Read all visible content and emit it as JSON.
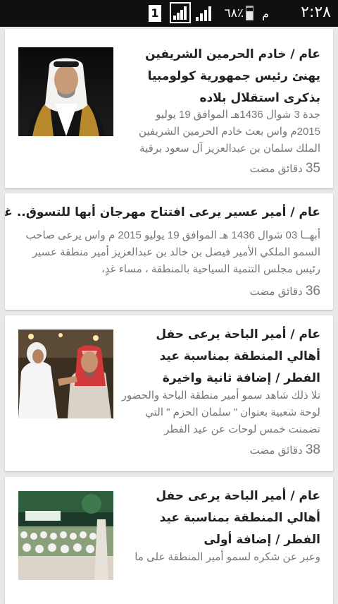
{
  "status_bar": {
    "time": "٢:٢٨",
    "period": "م",
    "battery_percent": "٦٨٪",
    "battery_level": 0.68,
    "sim_slot": "1"
  },
  "articles": [
    {
      "title": "عام / خادم الحرمين الشريفين يهنئ رئيس جمهورية كولومبيا بذكرى استقلال بلاده",
      "summary": "جدة 3 شوال 1436هـ الموافق 19 يوليو 2015م واس بعث خادم الحرمين الشريفين الملك سلمان بن عبدالعزيز آل سعود برقية",
      "time_num": "35",
      "time_text": "دقائق مضت",
      "has_image": true,
      "image_icon": "portrait-photo"
    },
    {
      "title": "عام / أمير عسير يرعى افتتاح مهرجان أبها للتسوق.. غدًا",
      "summary": "أبهــا 03 شوال 1436 هـ الموافق 19 يوليو 2015 م واس يرعى صاحب السمو الملكي الأمير فيصل بن خالد بن عبدالعزيز أمير منطقة عسير رئيس مجلس التنمية السياحية بالمنطقة ، مساء غدٍ،",
      "time_num": "36",
      "time_text": "دقائق مضت",
      "has_image": false
    },
    {
      "title": "عام / أمير الباحة يرعى حفل أهالي المنطقة بمناسبة عيد الفطر / إضافة ثانية واخيرة",
      "summary": "تلا ذلك شاهد سمو أمير منطقة الباحة والحضور لوحة شعبية بعنوان \" سلمان الحزم \" التي تضمنت خمس لوحات عن عيد الفطر",
      "time_num": "38",
      "time_text": "دقائق مضت",
      "has_image": true,
      "image_icon": "event-photo"
    },
    {
      "title": "عام / أمير الباحة يرعى حفل أهالي المنطقة بمناسبة عيد الفطر / إضافة أولى",
      "summary": "وعبر عن شكره لسمو أمير المنطقة على ما",
      "has_image": true,
      "image_icon": "crowd-photo"
    }
  ]
}
